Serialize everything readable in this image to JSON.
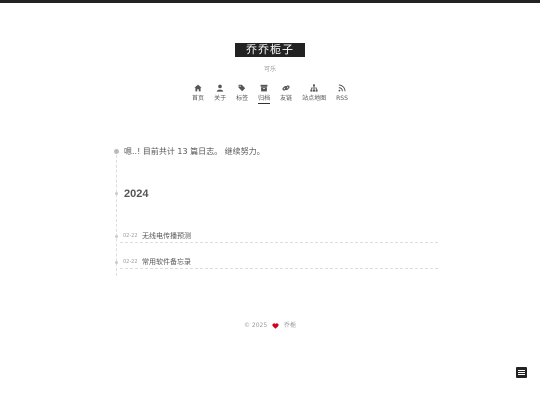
{
  "site": {
    "title": "乔乔栀子",
    "subtitle": "可乐"
  },
  "menu": [
    {
      "label": "首页",
      "icon": "home-icon"
    },
    {
      "label": "关于",
      "icon": "user-icon"
    },
    {
      "label": "标签",
      "icon": "tags-icon"
    },
    {
      "label": "归档",
      "icon": "archive-icon",
      "active": true
    },
    {
      "label": "友链",
      "icon": "link-icon"
    },
    {
      "label": "站点地图",
      "icon": "sitemap-icon"
    },
    {
      "label": "RSS",
      "icon": "rss-icon"
    }
  ],
  "archive": {
    "intro": "嗯..! 目前共计 13 篇日志。 继续努力。",
    "year": "2024",
    "posts": [
      {
        "date": "02-22",
        "title": "无线电传播预测"
      },
      {
        "date": "02-22",
        "title": "常用软件备忘录"
      }
    ]
  },
  "footer": {
    "copyright": "© 2025",
    "author": "乔栀"
  },
  "colors": {
    "heart": "#d0021b",
    "brand_bg": "#222222"
  }
}
